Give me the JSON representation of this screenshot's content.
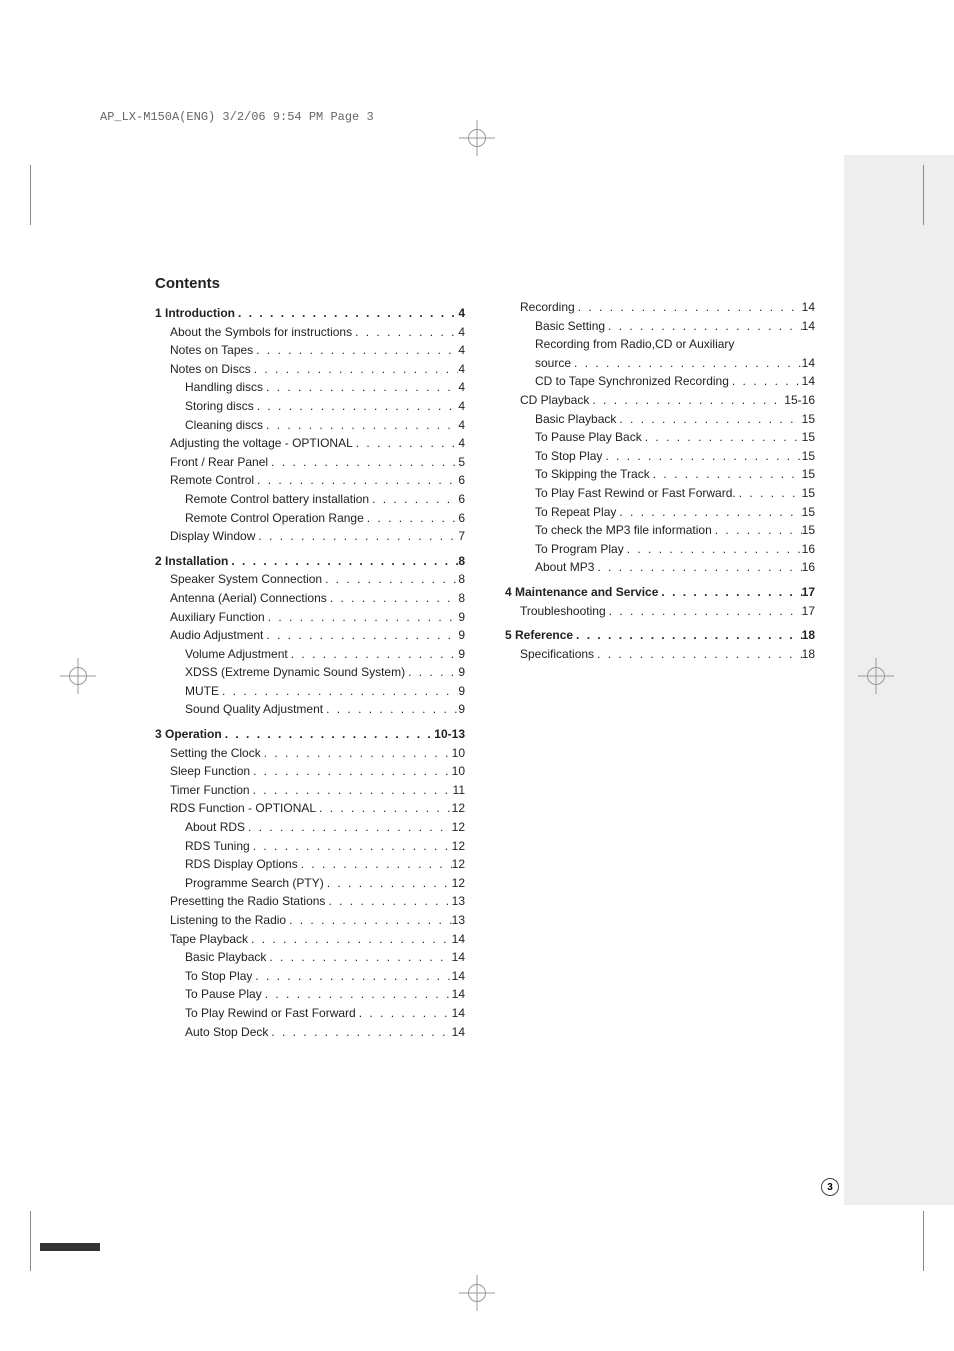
{
  "header": "AP_LX-M150A(ENG)  3/2/06  9:54 PM  Page 3",
  "title": "Contents",
  "page_number": "3",
  "sections": [
    {
      "num": "1",
      "title": "Introduction",
      "page": "4",
      "items": [
        {
          "label": "About the Symbols for instructions",
          "page": "4",
          "indent": 1
        },
        {
          "label": "Notes on Tapes",
          "page": "4",
          "indent": 1
        },
        {
          "label": "Notes on Discs",
          "page": "4",
          "indent": 1
        },
        {
          "label": "Handling discs",
          "page": "4",
          "indent": 2
        },
        {
          "label": "Storing discs",
          "page": "4",
          "indent": 2
        },
        {
          "label": "Cleaning discs",
          "page": "4",
          "indent": 2
        },
        {
          "label": "Adjusting the voltage - OPTIONAL",
          "page": "4",
          "indent": 1
        },
        {
          "label": "Front / Rear Panel",
          "page": "5",
          "indent": 1
        },
        {
          "label": "Remote Control",
          "page": "6",
          "indent": 1
        },
        {
          "label": "Remote Control battery installation",
          "page": "6",
          "indent": 2
        },
        {
          "label": "Remote Control Operation Range",
          "page": "6",
          "indent": 2
        },
        {
          "label": "Display Window",
          "page": "7",
          "indent": 1
        }
      ]
    },
    {
      "num": "2",
      "title": "Installation",
      "page": "8",
      "items": [
        {
          "label": "Speaker System Connection",
          "page": "8",
          "indent": 1
        },
        {
          "label": "Antenna (Aerial) Connections",
          "page": "8",
          "indent": 1
        },
        {
          "label": "Auxiliary Function",
          "page": "9",
          "indent": 1
        },
        {
          "label": "Audio Adjustment",
          "page": "9",
          "indent": 1
        },
        {
          "label": "Volume Adjustment",
          "page": "9",
          "indent": 2
        },
        {
          "label": "XDSS (Extreme Dynamic Sound System)",
          "page": "9",
          "indent": 2
        },
        {
          "label": "MUTE",
          "page": "9",
          "indent": 2
        },
        {
          "label": "Sound Quality Adjustment",
          "page": "9",
          "indent": 2
        }
      ]
    },
    {
      "num": "3",
      "title": "Operation",
      "page": "10-13",
      "items": [
        {
          "label": "Setting the Clock",
          "page": "10",
          "indent": 1
        },
        {
          "label": "Sleep Function",
          "page": "10",
          "indent": 1
        },
        {
          "label": "Timer Function",
          "page": "11",
          "indent": 1
        },
        {
          "label": "RDS Function - OPTIONAL",
          "page": "12",
          "indent": 1
        },
        {
          "label": "About RDS",
          "page": "12",
          "indent": 2
        },
        {
          "label": "RDS Tuning",
          "page": "12",
          "indent": 2
        },
        {
          "label": "RDS Display Options",
          "page": "12",
          "indent": 2
        },
        {
          "label": "Programme Search (PTY)",
          "page": "12",
          "indent": 2
        },
        {
          "label": "Presetting the Radio Stations",
          "page": "13",
          "indent": 1
        },
        {
          "label": "Listening to the Radio",
          "page": "13",
          "indent": 1
        },
        {
          "label": "Tape Playback",
          "page": "14",
          "indent": 1
        },
        {
          "label": "Basic Playback",
          "page": "14",
          "indent": 2
        },
        {
          "label": "To Stop Play",
          "page": "14",
          "indent": 2
        },
        {
          "label": "To Pause Play",
          "page": "14",
          "indent": 2
        },
        {
          "label": "To Play Rewind or Fast Forward",
          "page": "14",
          "indent": 2
        },
        {
          "label": "Auto Stop Deck",
          "page": "14",
          "indent": 2
        }
      ]
    }
  ],
  "right_col": [
    {
      "label": "Recording",
      "page": "14",
      "indent": 1
    },
    {
      "label": "Basic Setting",
      "page": "14",
      "indent": 2
    },
    {
      "label": "Recording from Radio,CD or Auxiliary source",
      "page": "14",
      "indent": 2,
      "wrap": true
    },
    {
      "label": "CD to Tape Synchronized Recording",
      "page": "14",
      "indent": 2
    },
    {
      "label": "CD Playback",
      "page": "15-16",
      "indent": 1
    },
    {
      "label": "Basic Playback",
      "page": "15",
      "indent": 2
    },
    {
      "label": "To Pause Play Back",
      "page": "15",
      "indent": 2
    },
    {
      "label": "To Stop Play",
      "page": "15",
      "indent": 2
    },
    {
      "label": "To Skipping the Track",
      "page": "15",
      "indent": 2
    },
    {
      "label": "To Play Fast Rewind or Fast Forward.",
      "page": "15",
      "indent": 2
    },
    {
      "label": "To Repeat Play",
      "page": "15",
      "indent": 2
    },
    {
      "label": "To check the MP3 file information",
      "page": "15",
      "indent": 2
    },
    {
      "label": "To Program Play",
      "page": "16",
      "indent": 2
    },
    {
      "label": "About MP3",
      "page": "16",
      "indent": 2
    }
  ],
  "right_sections": [
    {
      "num": "4",
      "title": "Maintenance and Service",
      "page": "17",
      "items": [
        {
          "label": "Troubleshooting",
          "page": "17",
          "indent": 1
        }
      ]
    },
    {
      "num": "5",
      "title": "Reference",
      "page": "18",
      "items": [
        {
          "label": "Specifications",
          "page": "18",
          "indent": 1
        }
      ]
    }
  ]
}
